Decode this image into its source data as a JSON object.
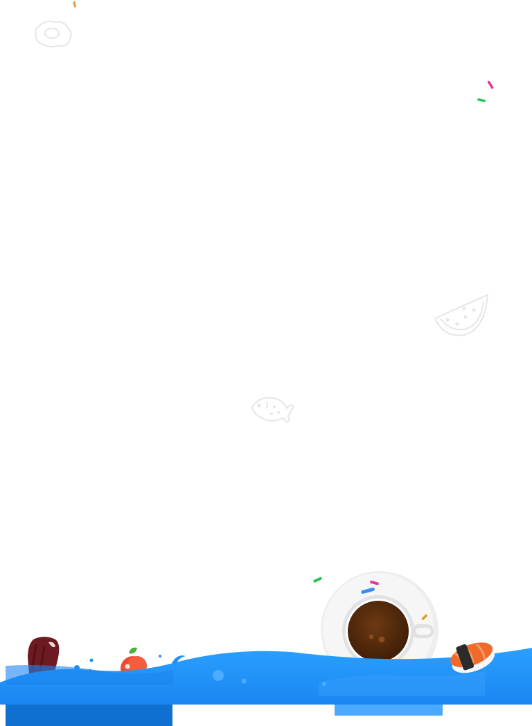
{
  "page": {
    "background": "#ffffff"
  },
  "colors": {
    "wave_primary": "#1e90f7",
    "wave_light": "#4aa8ff",
    "wave_dark": "#1070d0",
    "outline_faint": "#e6e6e6",
    "popsicle": "#6e1a22",
    "apple": "#f24a32",
    "coffee": "#5a2d0c",
    "sushi_salmon": "#f06a2a",
    "sprinkle_pink": "#e7358f",
    "sprinkle_green": "#22c35a",
    "sprinkle_orange": "#e59b2d",
    "sprinkle_blue": "#3b8df2"
  },
  "decorations": {
    "outline_icons": [
      "fried-egg-icon",
      "watermelon-slice-icon",
      "fish-icon"
    ],
    "foods": [
      "popsicle-icon",
      "apple-icon",
      "coffee-cup-icon",
      "sushi-icon"
    ]
  }
}
